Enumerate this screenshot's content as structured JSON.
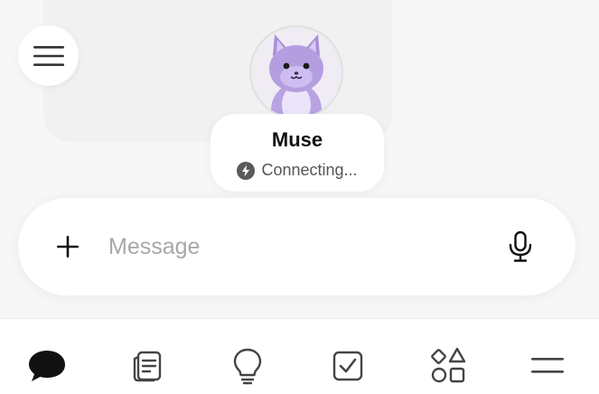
{
  "avatar": {
    "character": "purple-cat",
    "icon": "cat-avatar"
  },
  "assistant": {
    "name": "Muse",
    "status": "Connecting...",
    "status_icon": "lightning-bolt-icon"
  },
  "composer": {
    "placeholder": "Message",
    "add_icon": "plus-icon",
    "voice_icon": "microphone-icon"
  },
  "tabs": [
    {
      "id": "chat",
      "icon": "chat-bubble-icon",
      "active": true
    },
    {
      "id": "notes",
      "icon": "notes-icon",
      "active": false
    },
    {
      "id": "ideas",
      "icon": "lightbulb-icon",
      "active": false
    },
    {
      "id": "tasks",
      "icon": "checkbox-icon",
      "active": false
    },
    {
      "id": "apps",
      "icon": "shapes-icon",
      "active": false
    },
    {
      "id": "more",
      "icon": "menu-icon",
      "active": false
    }
  ],
  "colors": {
    "accent": "#111111",
    "background": "#f7f7f7",
    "placeholder": "#a8a8a8",
    "avatar_purple": "#b9a3e3"
  }
}
